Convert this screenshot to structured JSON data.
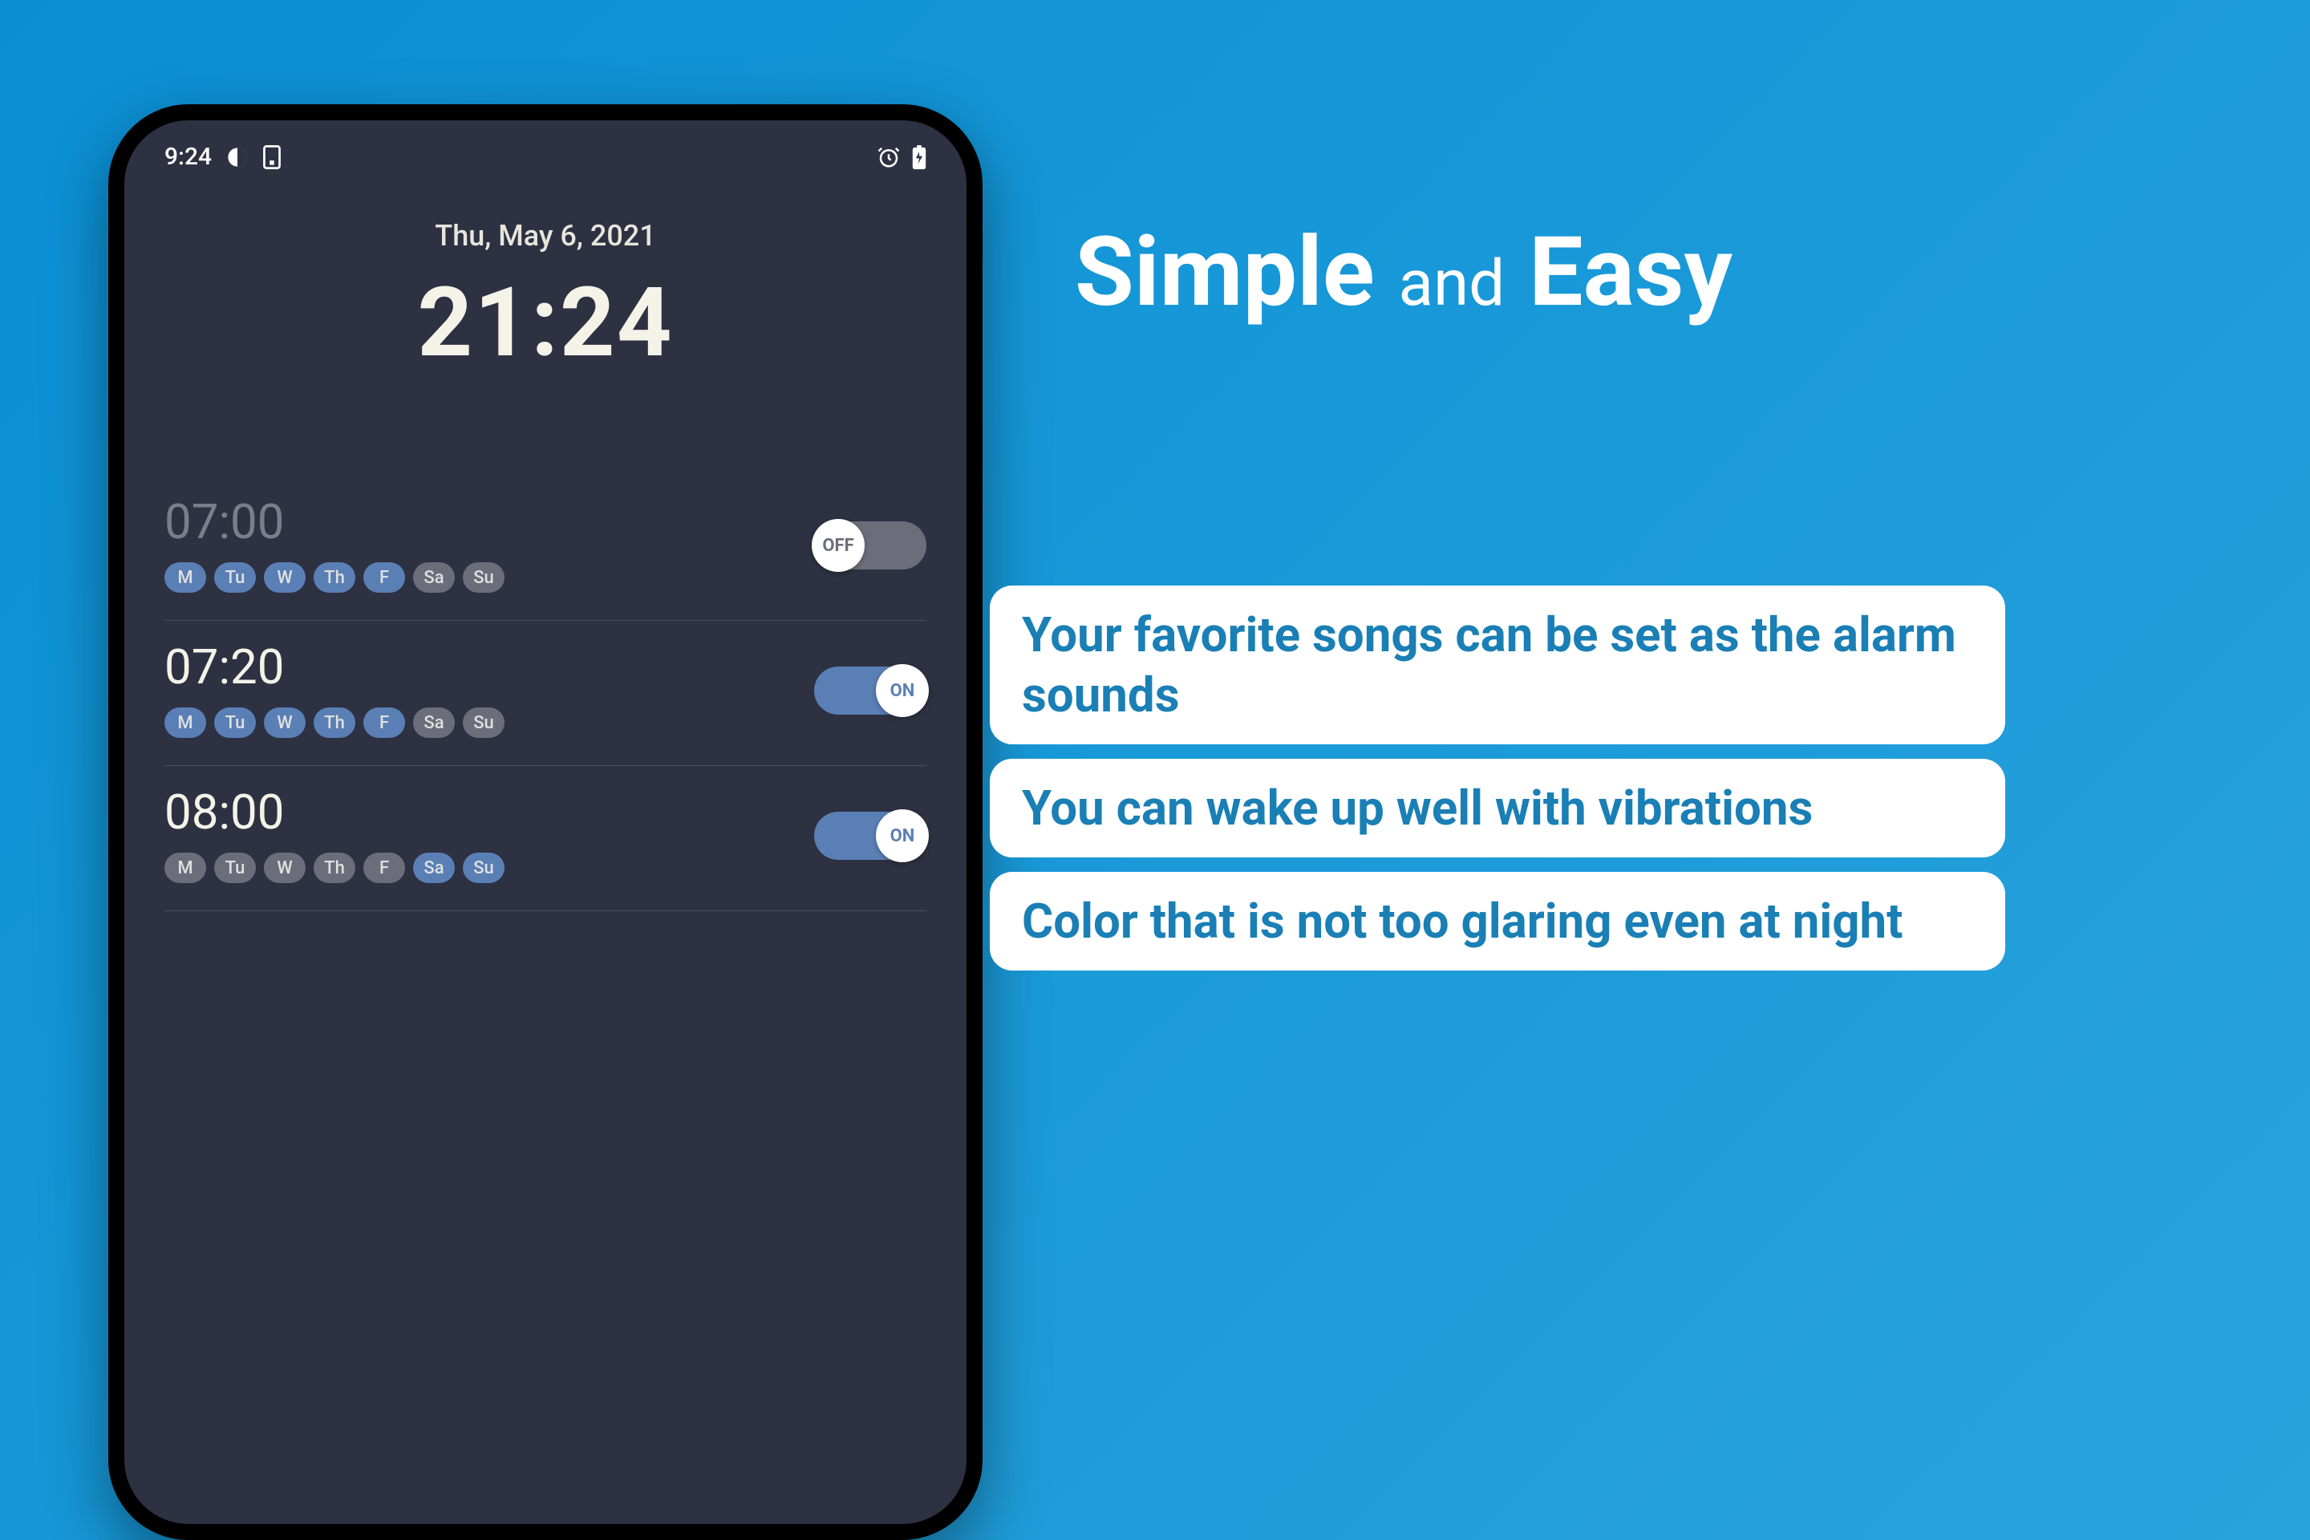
{
  "status_bar": {
    "time": "9:24"
  },
  "clock": {
    "date": "Thu, May 6, 2021",
    "time": "21:24"
  },
  "toggle_labels": {
    "on": "ON",
    "off": "OFF"
  },
  "days": [
    "M",
    "Tu",
    "W",
    "Th",
    "F",
    "Sa",
    "Su"
  ],
  "alarms": [
    {
      "time": "07:00",
      "enabled": false,
      "active_days": [
        true,
        true,
        true,
        true,
        true,
        false,
        false
      ]
    },
    {
      "time": "07:20",
      "enabled": true,
      "active_days": [
        true,
        true,
        true,
        true,
        true,
        false,
        false
      ]
    },
    {
      "time": "08:00",
      "enabled": true,
      "active_days": [
        false,
        false,
        false,
        false,
        false,
        true,
        true
      ]
    }
  ],
  "headline": {
    "word1": "Simple",
    "word2": "and",
    "word3": "Easy"
  },
  "features": [
    "Your favorite songs can be set as the alarm sounds",
    "You can wake up well with vibrations",
    "Color that is not too glaring even at night"
  ]
}
